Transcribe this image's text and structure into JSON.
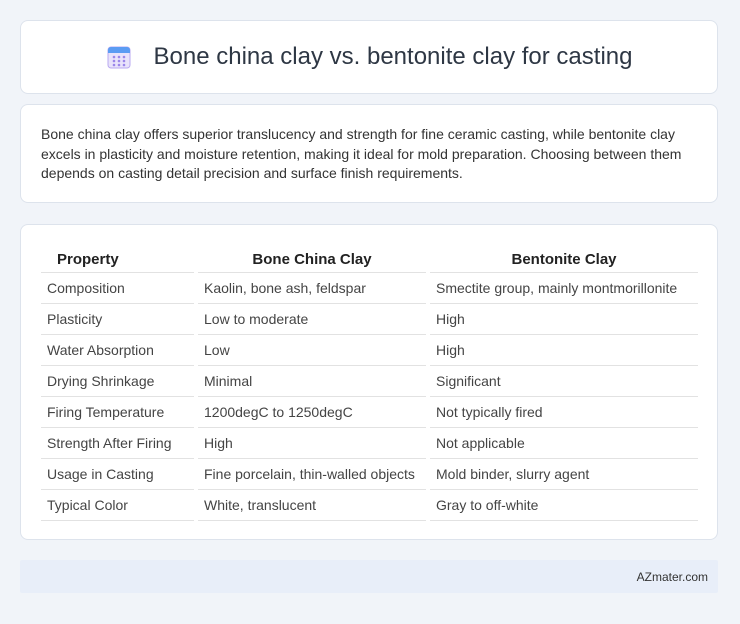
{
  "header": {
    "title": "Bone china clay vs. bentonite clay for casting",
    "icon": "calendar-icon"
  },
  "summary": {
    "text": "Bone china clay offers superior translucency and strength for fine ceramic casting, while bentonite clay excels in plasticity and moisture retention, making it ideal for mold preparation. Choosing between them depends on casting detail precision and surface finish requirements."
  },
  "table": {
    "headers": [
      "Property",
      "Bone China Clay",
      "Bentonite Clay"
    ],
    "rows": [
      [
        "Composition",
        "Kaolin, bone ash, feldspar",
        "Smectite group, mainly montmorillonite"
      ],
      [
        "Plasticity",
        "Low to moderate",
        "High"
      ],
      [
        "Water Absorption",
        "Low",
        "High"
      ],
      [
        "Drying Shrinkage",
        "Minimal",
        "Significant"
      ],
      [
        "Firing Temperature",
        "1200degC to 1250degC",
        "Not typically fired"
      ],
      [
        "Strength After Firing",
        "High",
        "Not applicable"
      ],
      [
        "Usage in Casting",
        "Fine porcelain, thin-walled objects",
        "Mold binder, slurry agent"
      ],
      [
        "Typical Color",
        "White, translucent",
        "Gray to off-white"
      ]
    ]
  },
  "footer": {
    "text": "AZmater.com"
  }
}
